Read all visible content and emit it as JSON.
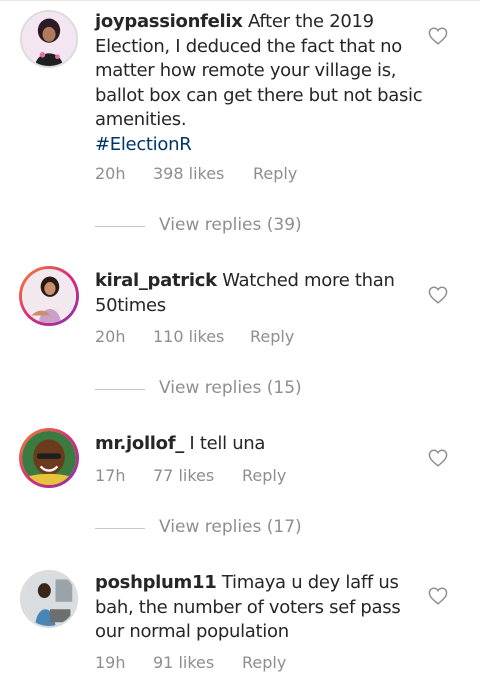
{
  "comments": [
    {
      "username": "joypassionfelix",
      "text": "After the 2019 Election, I deduced the fact that no matter how remote your village is, ballot box can get there but not basic amenities.",
      "hashtag": "#ElectionR",
      "time": "20h",
      "likes": "398 likes",
      "reply": "Reply",
      "view_replies": "View replies (39)"
    },
    {
      "username": "kiral_patrick",
      "text": "Watched more than 50times",
      "time": "20h",
      "likes": "110 likes",
      "reply": "Reply",
      "view_replies": "View replies (15)"
    },
    {
      "username": "mr.jollof_",
      "text": "I tell una",
      "time": "17h",
      "likes": "77 likes",
      "reply": "Reply",
      "view_replies": "View replies (17)"
    },
    {
      "username": "poshplum11",
      "text": "Timaya u dey laff us bah, the number of voters sef pass our normal population",
      "time": "19h",
      "likes": "91 likes",
      "reply": "Reply"
    }
  ],
  "icons": {
    "like": "heart-outline-icon"
  },
  "colors": {
    "hashtag": "#003569",
    "meta": "#8e8e8e"
  }
}
